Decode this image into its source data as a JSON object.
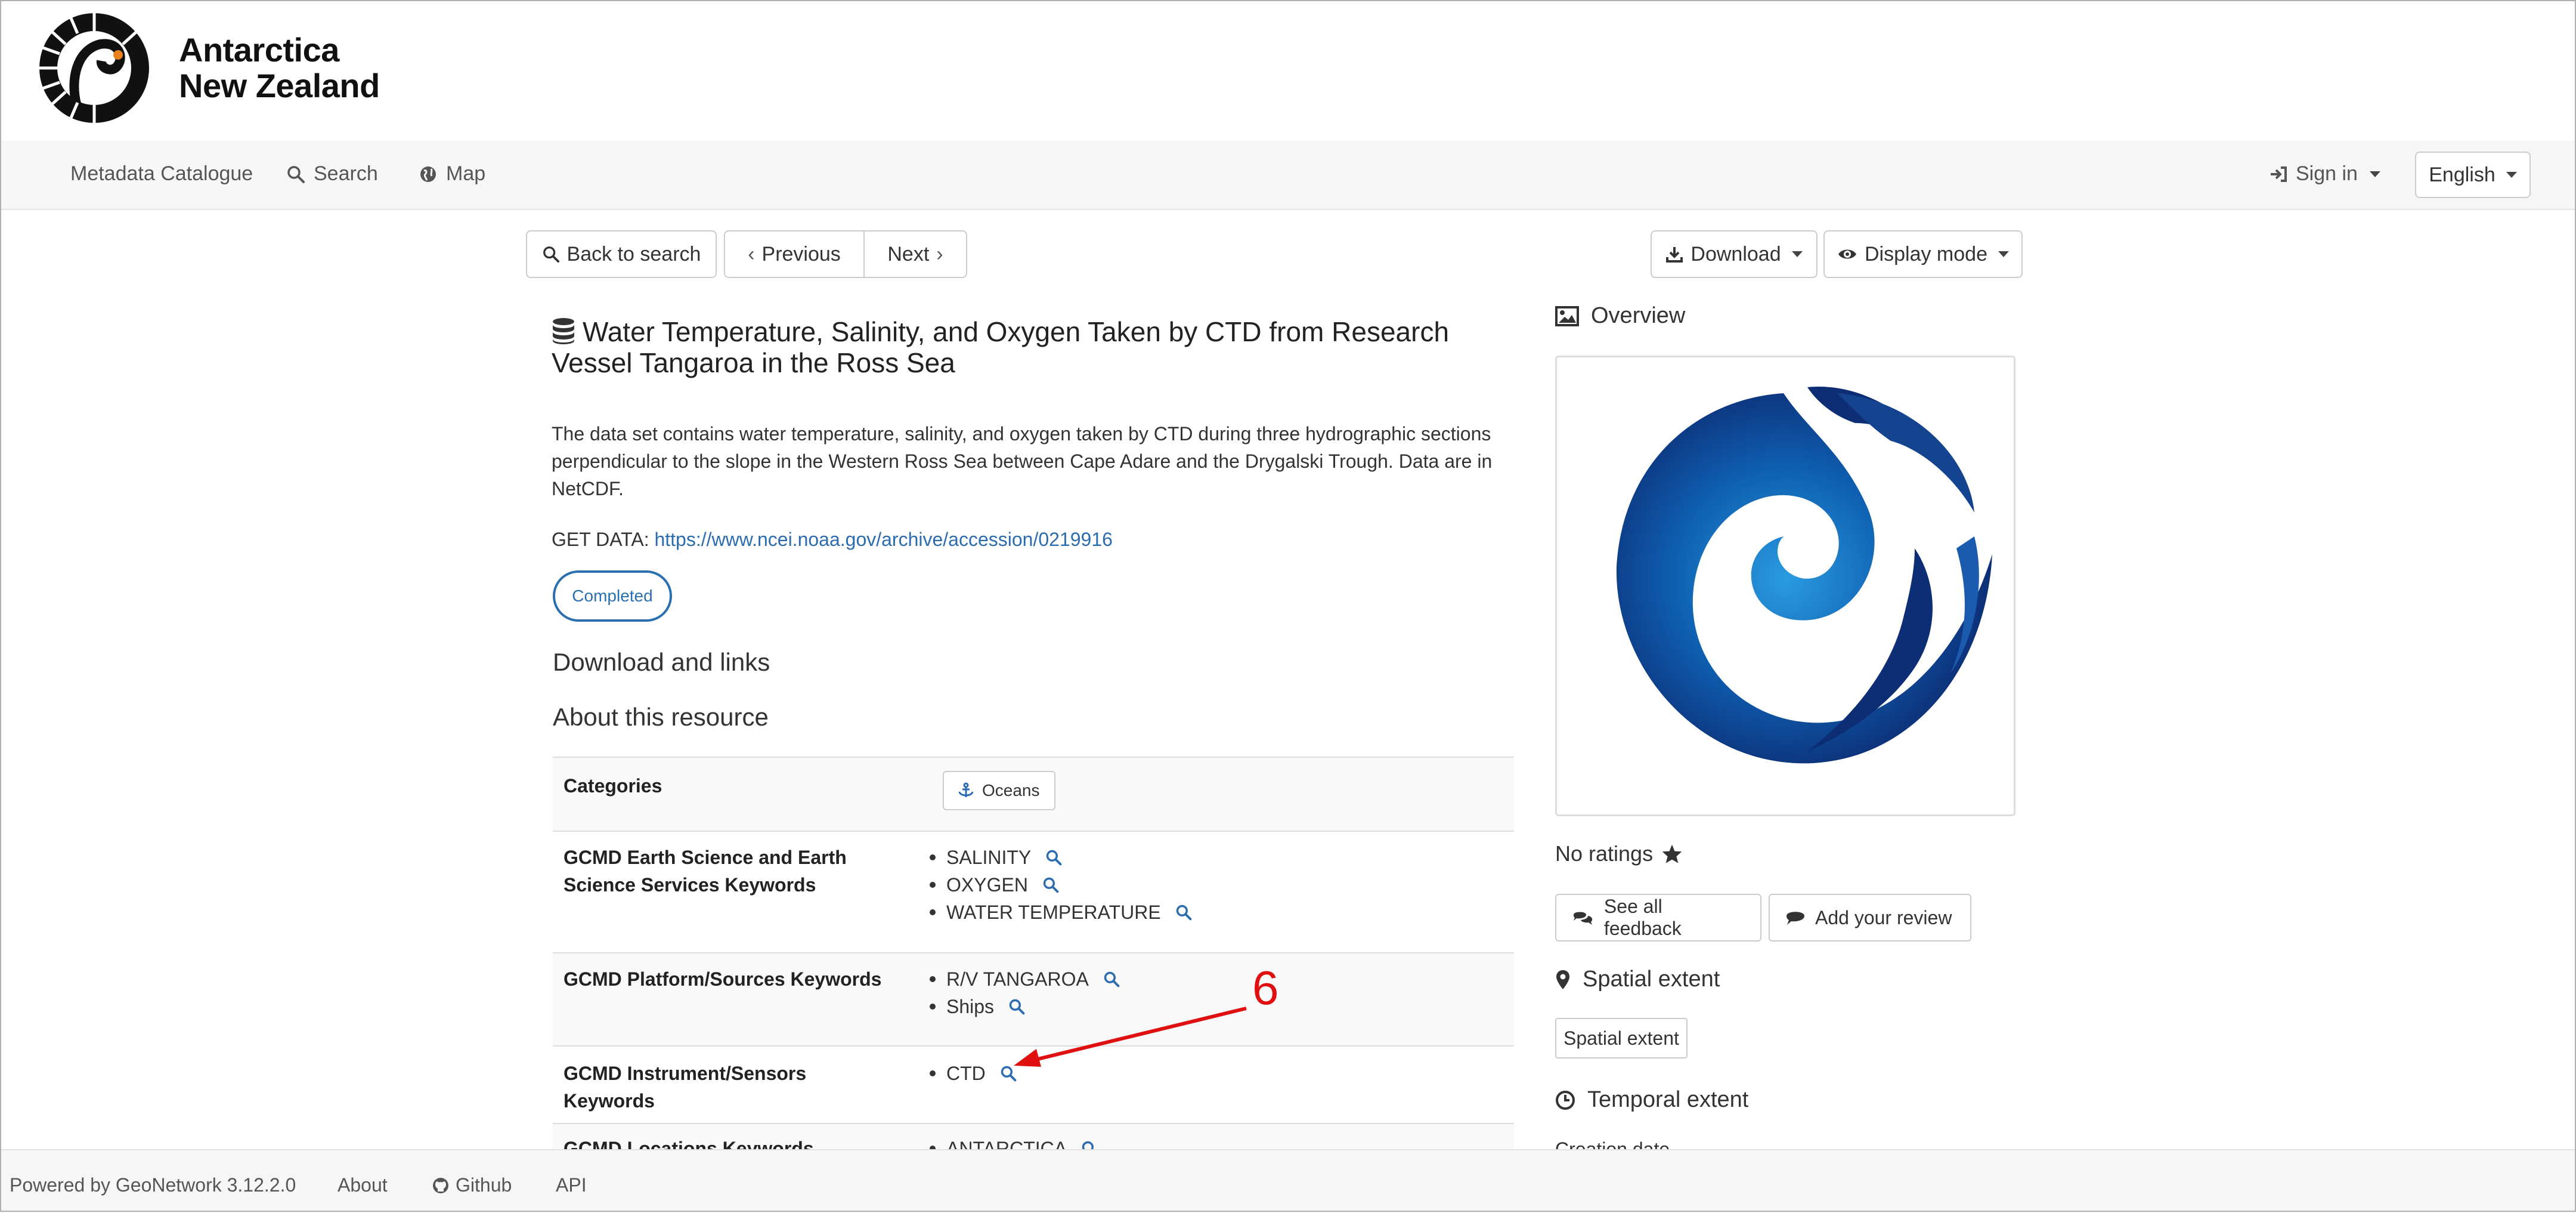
{
  "brand": {
    "line1": "Antarctica",
    "line2": "New Zealand"
  },
  "topnav": {
    "catalogue": "Metadata Catalogue",
    "search": "Search",
    "map": "Map",
    "signin": "Sign in",
    "language": "English"
  },
  "toolbar": {
    "back": "Back to search",
    "previous": "Previous",
    "next": "Next",
    "download": "Download",
    "display_mode": "Display mode"
  },
  "record": {
    "title": "Water Temperature, Salinity, and Oxygen Taken by CTD from Research Vessel Tangaroa in the Ross Sea",
    "description": "The data set contains water temperature, salinity, and oxygen taken by CTD during three hydrographic sections perpendicular to the slope in the Western Ross Sea between Cape Adare and the Drygalski Trough. Data are in NetCDF.",
    "get_data_label": "GET DATA:",
    "get_data_url": "https://www.ncei.noaa.gov/archive/accession/0219916",
    "status": "Completed",
    "download_links_heading": "Download and links",
    "about_heading": "About this resource"
  },
  "table": {
    "categories_label": "Categories",
    "categories_value": "Oceans",
    "rows": [
      {
        "label": "GCMD Earth Science and Earth Science Services Keywords",
        "items": [
          "SALINITY",
          "OXYGEN",
          "WATER TEMPERATURE"
        ]
      },
      {
        "label": "GCMD Platform/Sources Keywords",
        "items": [
          "R/V TANGAROA",
          "Ships"
        ]
      },
      {
        "label": "GCMD Instrument/Sensors Keywords",
        "items": [
          "CTD"
        ]
      },
      {
        "label": "GCMD Locations Keywords",
        "items": [
          "ANTARCTICA"
        ]
      }
    ]
  },
  "right_panel": {
    "overview": "Overview",
    "no_ratings": "No ratings",
    "see_feedback": "See all feedback",
    "add_review": "Add your review",
    "spatial_heading": "Spatial extent",
    "spatial_button": "Spatial extent",
    "temporal_heading": "Temporal extent",
    "temporal_clipped": "Creation date"
  },
  "annotation": {
    "label": "6",
    "color": "#e01010"
  },
  "footer": {
    "powered": "Powered by GeoNetwork 3.12.2.0",
    "about": "About",
    "github": "Github",
    "api": "API"
  },
  "colors": {
    "link": "#2b6cb0",
    "badge": "#2a6fb0",
    "annotation": "#e01010",
    "logo_blue": "#0d2d74"
  }
}
